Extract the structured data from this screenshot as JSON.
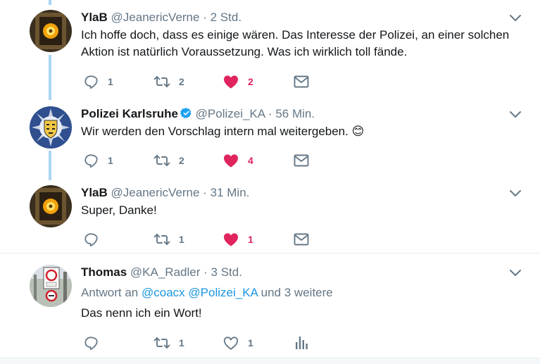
{
  "tweets": [
    {
      "name": "YlaB",
      "handle": "@JeanericVerne",
      "sep": "·",
      "time": "2 Std.",
      "text": "Ich hoffe doch, dass es einige wären. Das Interesse der Polizei, an einer solchen Aktion ist natürlich Voraussetzung. Was ich wirklich toll fände.",
      "replies": "1",
      "retweets": "2",
      "likes": "2",
      "liked": true
    },
    {
      "name": "Polizei Karlsruhe",
      "verified": true,
      "handle": "@Polizei_KA",
      "sep": "·",
      "time": "56 Min.",
      "text": "Wir werden den Vorschlag intern mal weitergeben. 😊",
      "replies": "1",
      "retweets": "2",
      "likes": "4",
      "liked": true
    },
    {
      "name": "YlaB",
      "handle": "@JeanericVerne",
      "sep": "·",
      "time": "31 Min.",
      "text": "Super, Danke!",
      "replies": "",
      "retweets": "1",
      "likes": "1",
      "liked": true
    },
    {
      "name": "Thomas",
      "handle": "@KA_Radler",
      "sep": "·",
      "time": "3 Std.",
      "reply_prefix": "Antwort an",
      "reply_mention_1": "@coacx",
      "reply_mention_2": "@Polizei_KA",
      "reply_suffix": "und 3 weitere",
      "text": "Das nenn ich ein Wort!",
      "replies": "",
      "retweets": "1",
      "likes": "1",
      "liked": false
    }
  ],
  "colors": {
    "like_active": "#e0245e",
    "icon_gray": "#657786",
    "thread_line": "#a9d5f5",
    "link": "#1b95e0",
    "verified": "#1da1f2"
  },
  "icons": [
    "reply-icon",
    "retweet-icon",
    "heart-icon",
    "envelope-icon",
    "analytics-icon",
    "chevron-down-icon",
    "verified-badge-icon"
  ]
}
